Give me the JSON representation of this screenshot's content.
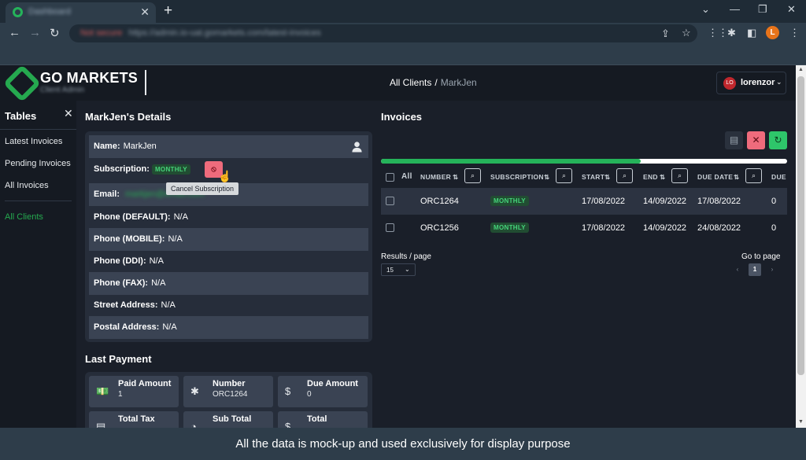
{
  "browser": {
    "tab_title": "Dashboard",
    "omnibox_security": "Not secure",
    "omnibox_url": "https://admin.io-uat.gomarkets.com/latest-invoices",
    "profile_initial": "L"
  },
  "header": {
    "logo_text": "GO MARKETS",
    "logo_sub": "Client Admin",
    "breadcrumb_root": "All Clients",
    "breadcrumb_sep": "/",
    "breadcrumb_current": "MarkJen",
    "user_initials": "LO",
    "user_name": "lorenzor"
  },
  "sidebar": {
    "title": "Tables",
    "items": [
      {
        "label": "Latest Invoices"
      },
      {
        "label": "Pending Invoices"
      },
      {
        "label": "All Invoices"
      },
      {
        "label": "All Clients"
      }
    ]
  },
  "details": {
    "title": "MarkJen's Details",
    "name_label": "Name:",
    "name_value": "MarkJen",
    "subscription_label": "Subscription:",
    "subscription_value": "MONTHLY",
    "cancel_tooltip": "Cancel Subscription",
    "email_label": "Email:",
    "email_value": "markjen@email.com",
    "rows": [
      {
        "label": "Phone (DEFAULT):",
        "value": "N/A"
      },
      {
        "label": "Phone (MOBILE):",
        "value": "N/A"
      },
      {
        "label": "Phone (DDI):",
        "value": "N/A"
      },
      {
        "label": "Phone (FAX):",
        "value": "N/A"
      },
      {
        "label": "Street Address:",
        "value": "N/A"
      },
      {
        "label": "Postal Address:",
        "value": "N/A"
      }
    ]
  },
  "last_payment": {
    "title": "Last Payment",
    "tiles": [
      {
        "label": "Paid Amount",
        "value": "1",
        "icon": "money-icon"
      },
      {
        "label": "Number",
        "value": "ORC1264",
        "icon": "asterisk-icon"
      },
      {
        "label": "Due Amount",
        "value": "0",
        "icon": "hand-coin-icon"
      },
      {
        "label": "Total Tax",
        "value": "",
        "icon": "receipt-icon"
      },
      {
        "label": "Sub Total",
        "value": "",
        "icon": "pie-icon"
      },
      {
        "label": "Total",
        "value": "",
        "icon": "dollar-icon"
      }
    ]
  },
  "invoices": {
    "title": "Invoices",
    "progress": 0.64,
    "columns": {
      "all": "All",
      "number": "NUMBER",
      "subscription": "SUBSCRIPTION",
      "start": "START",
      "end": "END",
      "due_date": "DUE DATE",
      "due": "DUE"
    },
    "rows": [
      {
        "number": "ORC1264",
        "subscription": "MONTHLY",
        "start": "17/08/2022",
        "end": "14/09/2022",
        "due_date": "17/08/2022",
        "due": "0"
      },
      {
        "number": "ORC1256",
        "subscription": "MONTHLY",
        "start": "17/08/2022",
        "end": "14/09/2022",
        "due_date": "24/08/2022",
        "due": "0"
      }
    ],
    "results_label": "Results / page",
    "results_value": "15",
    "goto_label": "Go to page",
    "current_page": "1",
    "prev": "‹",
    "next": "›"
  },
  "caption": "All the data is mock-up and used exclusively for display purpose"
}
